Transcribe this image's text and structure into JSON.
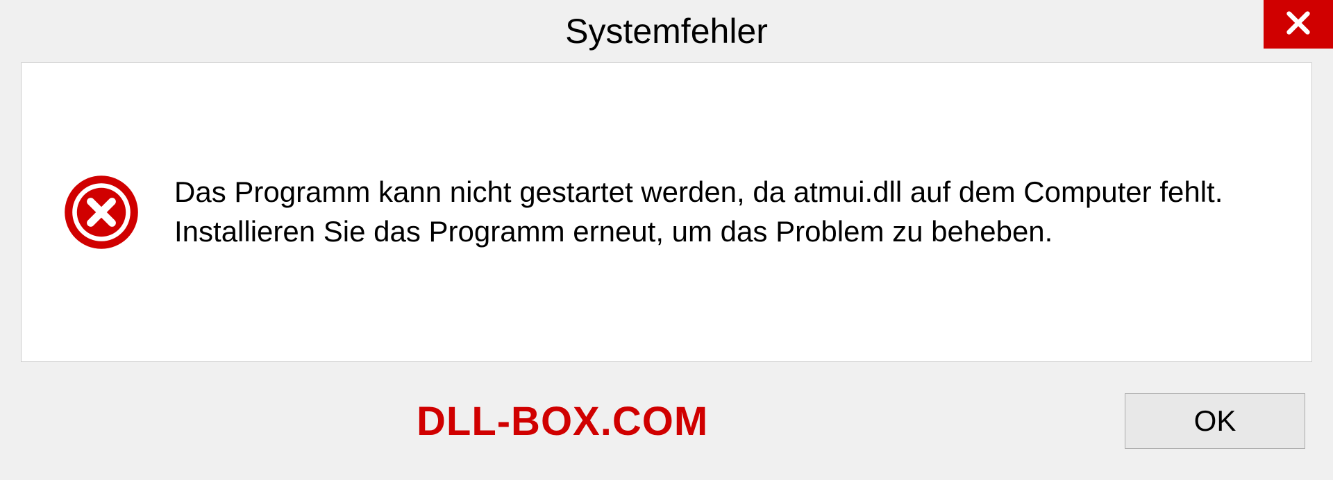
{
  "dialog": {
    "title": "Systemfehler",
    "message": "Das Programm kann nicht gestartet werden, da atmui.dll auf dem Computer fehlt. Installieren Sie das Programm erneut, um das Problem zu beheben.",
    "ok_label": "OK"
  },
  "watermark": "DLL-BOX.COM",
  "colors": {
    "close_bg": "#d00000",
    "error_red": "#d00000",
    "watermark": "#d00000"
  }
}
